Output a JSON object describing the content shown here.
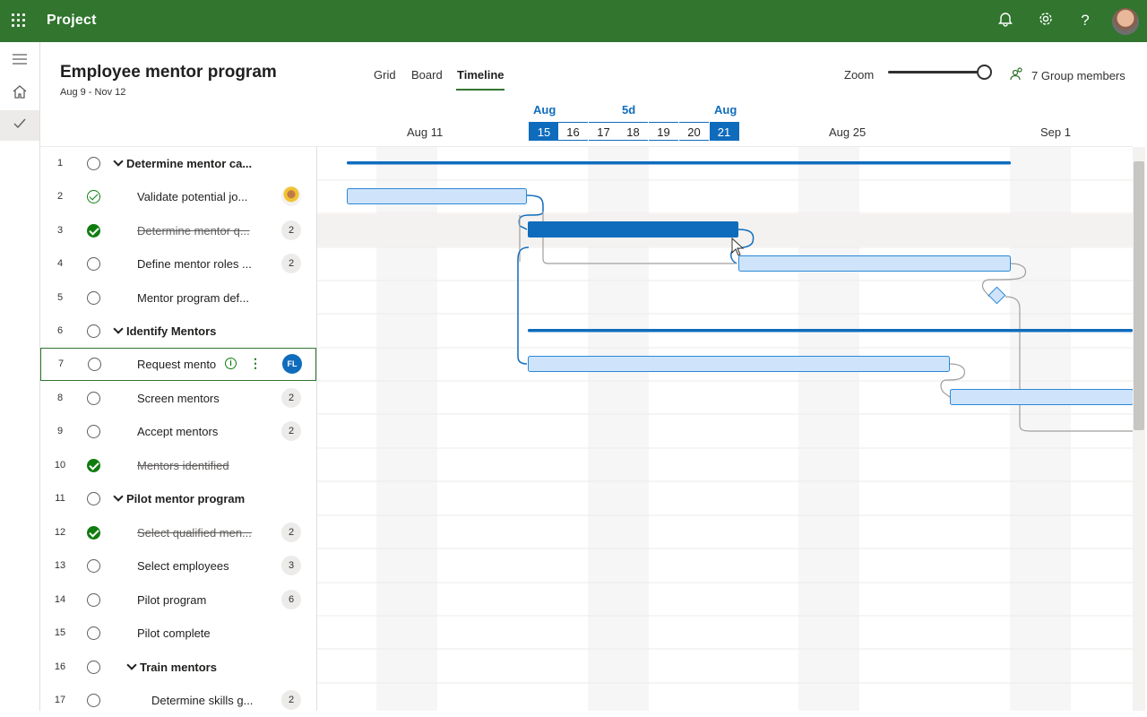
{
  "app": {
    "name": "Project"
  },
  "header": {
    "title": "Employee mentor program",
    "date_range": "Aug 9 - Nov 12",
    "tabs": [
      "Grid",
      "Board",
      "Timeline"
    ],
    "selected_tab": "Timeline",
    "zoom_label": "Zoom",
    "zoom_level": 1.0,
    "members_label": "7 Group members"
  },
  "timeline_header": {
    "week_labels": [
      "Aug 11",
      "Aug 25",
      "Sep 1"
    ],
    "selection_month_start": "Aug",
    "selection_duration": "5d",
    "selection_month_end": "Aug",
    "days": [
      "15",
      "16",
      "17",
      "18",
      "19",
      "20",
      "21"
    ]
  },
  "tasks": [
    {
      "num": "1",
      "name": "Determine mentor ca...",
      "group": true,
      "status": "open",
      "badge": ""
    },
    {
      "num": "2",
      "name": "Validate potential jo...",
      "group": false,
      "status": "partial",
      "badge": ""
    },
    {
      "num": "3",
      "name": "Determine mentor q...",
      "group": false,
      "status": "done",
      "badge": "2"
    },
    {
      "num": "4",
      "name": "Define mentor roles ...",
      "group": false,
      "status": "open",
      "badge": "2"
    },
    {
      "num": "5",
      "name": "Mentor program def...",
      "group": false,
      "status": "open",
      "badge": ""
    },
    {
      "num": "6",
      "name": "Identify Mentors",
      "group": true,
      "status": "open",
      "badge": ""
    },
    {
      "num": "7",
      "name": "Request mento",
      "group": false,
      "status": "open",
      "badge": "FL"
    },
    {
      "num": "8",
      "name": "Screen mentors",
      "group": false,
      "status": "open",
      "badge": "2"
    },
    {
      "num": "9",
      "name": "Accept mentors",
      "group": false,
      "status": "open",
      "badge": "2"
    },
    {
      "num": "10",
      "name": "Mentors identified",
      "group": false,
      "status": "done",
      "badge": ""
    },
    {
      "num": "11",
      "name": "Pilot mentor program",
      "group": true,
      "status": "open",
      "badge": ""
    },
    {
      "num": "12",
      "name": "Select qualified men...",
      "group": false,
      "status": "done",
      "badge": "2"
    },
    {
      "num": "13",
      "name": "Select employees",
      "group": false,
      "status": "open",
      "badge": "3"
    },
    {
      "num": "14",
      "name": "Pilot program",
      "group": false,
      "status": "open",
      "badge": "6"
    },
    {
      "num": "15",
      "name": "Pilot complete",
      "group": false,
      "status": "open",
      "badge": ""
    },
    {
      "num": "16",
      "name": "Train mentors",
      "group": true,
      "status": "open",
      "badge": ""
    },
    {
      "num": "17",
      "name": "Determine skills g...",
      "group": false,
      "status": "open",
      "badge": "2"
    }
  ],
  "colors": {
    "brand_green": "#31752f",
    "accent_blue": "#0f6cbd",
    "bar_light": "#cfe4fa",
    "bar_border": "#2b88d8"
  },
  "icons": [
    "waffle-icon",
    "bell-icon",
    "settings-icon",
    "help-icon",
    "hamburger-icon",
    "home-icon",
    "check-icon",
    "members-icon",
    "info-icon",
    "more-icon"
  ]
}
